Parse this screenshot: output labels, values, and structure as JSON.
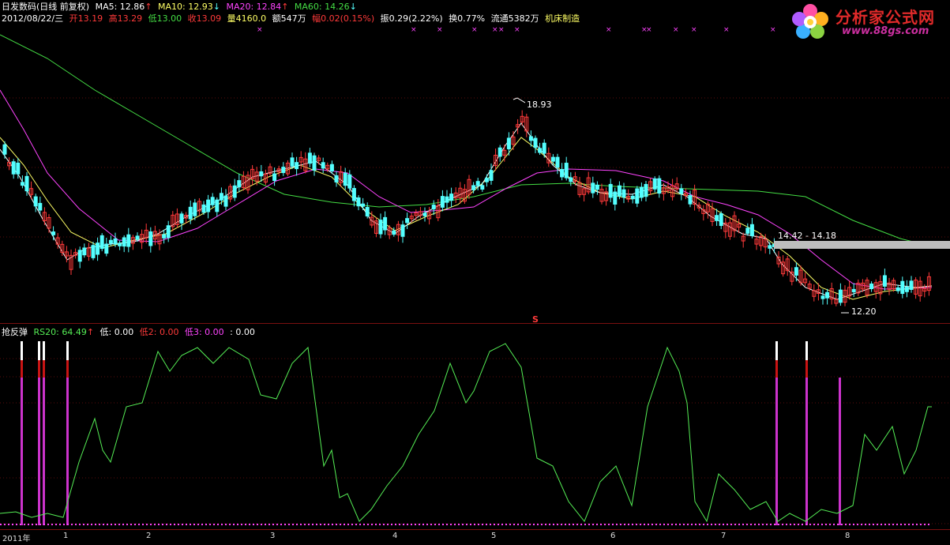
{
  "header": {
    "title": "日发数码(日线 前复权)",
    "ma5": "MA5: 12.86",
    "ma10": "MA10: 12.93",
    "ma20": "MA20: 12.84",
    "ma60": "MA60: 14.26",
    "date": "2012/08/22/三",
    "open": "开13.19",
    "high": "高13.29",
    "low": "低13.00",
    "close": "收13.09",
    "volume": "量4160.0",
    "amount": "额547万",
    "change": "幅0.02(0.15%)",
    "amplitude": "振0.29(2.22%)",
    "turnover": "换0.77%",
    "float_shares": "流通5382万",
    "sector": "机床制造"
  },
  "price_labels": {
    "high_label": "18.93",
    "low_label": "12.20",
    "gap_label": "14.42 - 14.18",
    "signal_mark": "S"
  },
  "indicator": {
    "name": "抢反弹",
    "rs20": "RS20: 64.49",
    "low_label": "低: 0.00",
    "low2_label": "低2: 0.00",
    "low3_label": "低3: 0.00",
    "extra_label": ": 0.00"
  },
  "axis_labels": [
    "2011年",
    "1",
    "2",
    "3",
    "4",
    "5",
    "6",
    "7",
    "8"
  ],
  "logo": {
    "name": "分析家公式网",
    "url": "www.88gs.com"
  },
  "colors": {
    "up": "#ff3a3a",
    "down": "#54ffff",
    "ma5": "#ffffff",
    "ma10": "#ffff66",
    "ma20": "#ff44ff",
    "ma60": "#44dd44",
    "rs": "#55ee55",
    "bar": "#cc33cc"
  }
}
